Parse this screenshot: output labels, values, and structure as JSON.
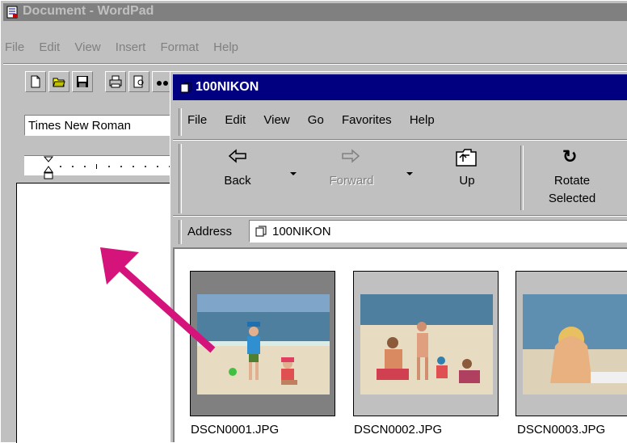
{
  "wordpad": {
    "title": "Document - WordPad",
    "menu": [
      "File",
      "Edit",
      "View",
      "Insert",
      "Format",
      "Help"
    ],
    "font_name": "Times New Roman"
  },
  "explorer": {
    "title": "100NIKON",
    "menu": [
      "File",
      "Edit",
      "View",
      "Go",
      "Favorites",
      "Help"
    ],
    "toolbar": {
      "back": "Back",
      "forward": "Forward",
      "up": "Up",
      "rotate_line1": "Rotate",
      "rotate_line2": "Selected",
      "rotate_glyph": "↻"
    },
    "address_label": "Address",
    "address_value": "100NIKON",
    "files": [
      {
        "name": "DSCN0001.JPG",
        "selected": true
      },
      {
        "name": "DSCN0002.JPG",
        "selected": false
      },
      {
        "name": "DSCN0003.JPG",
        "selected": false
      }
    ]
  },
  "colors": {
    "active_title": "#000080",
    "inactive_title": "#808080",
    "arrow": "#d4147a",
    "selected_thumb": "#808080"
  }
}
